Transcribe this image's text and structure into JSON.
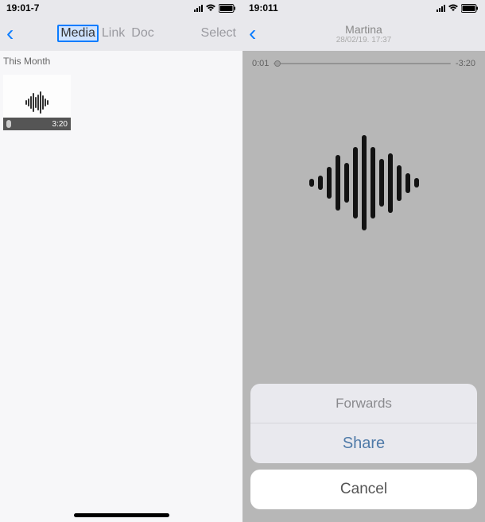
{
  "left": {
    "status": {
      "time": "19:01-7"
    },
    "tabs": {
      "media": "Media",
      "link": "Link",
      "doc": "Doc"
    },
    "select_label": "Select",
    "section_header": "This Month",
    "item": {
      "duration": "3:20"
    }
  },
  "right": {
    "status": {
      "time": "19:011"
    },
    "title": {
      "name": "Martina",
      "date": "28/02/19. 17:37"
    },
    "scrubber": {
      "elapsed": "0:01",
      "remaining": "-3:20"
    },
    "sheet": {
      "forwards": "Forwards",
      "share": "Share",
      "cancel": "Cancel"
    }
  }
}
